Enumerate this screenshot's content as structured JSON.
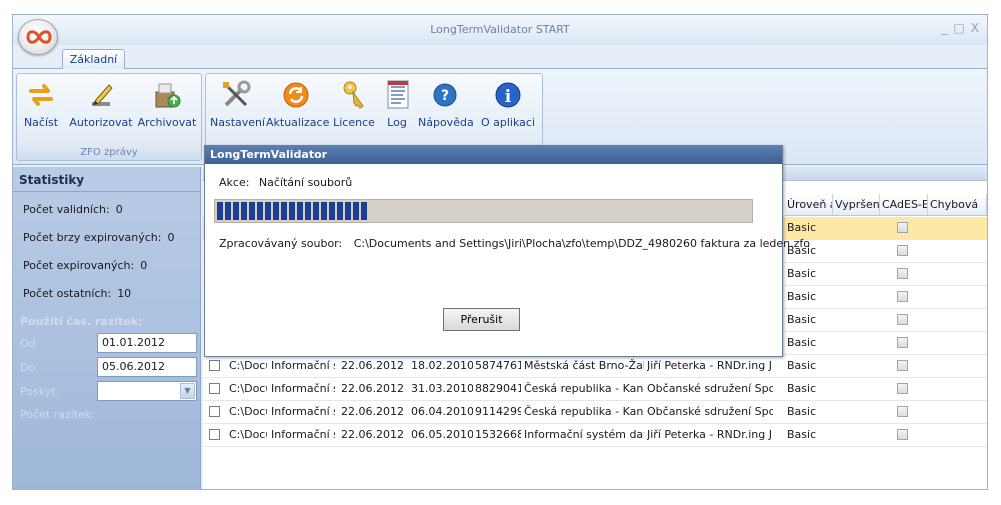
{
  "window": {
    "title": "LongTermValidator START",
    "controls": [
      "_",
      "□",
      "X"
    ]
  },
  "ribbon": {
    "tab": "Základní",
    "group1": {
      "label": "ZFO zprávy",
      "buttons": [
        {
          "label": "Načíst",
          "icon": "refresh-arrows-icon"
        },
        {
          "label": "Autorizovat",
          "icon": "pencil-icon"
        },
        {
          "label": "Archivovat",
          "icon": "archive-upload-icon"
        }
      ]
    },
    "group2": {
      "buttons": [
        {
          "label": "Nastavení",
          "icon": "tools-icon"
        },
        {
          "label": "Aktualizace",
          "icon": "update-icon"
        },
        {
          "label": "Licence",
          "icon": "key-icon"
        },
        {
          "label": "Log",
          "icon": "log-document-icon"
        },
        {
          "label": "Nápověda",
          "icon": "help-icon"
        },
        {
          "label": "O aplikaci",
          "icon": "info-icon"
        }
      ]
    }
  },
  "stats": {
    "title": "Statistiky",
    "items": [
      {
        "label": "Počet validních:",
        "value": "0"
      },
      {
        "label": "Počet brzy expirovaných:",
        "value": "0"
      },
      {
        "label": "Počet expirovaných:",
        "value": "0"
      },
      {
        "label": "Počet ostatních:",
        "value": "10"
      }
    ]
  },
  "timestamps": {
    "title": "Použití čas. razítek:",
    "od_label": "Od",
    "od_value": "01.01.2012",
    "do_label": "Do",
    "do_value": "05.06.2012",
    "poskytovatel_label": "Poskyt.",
    "pocet_label": "Počet razítek:"
  },
  "grid": {
    "headers": [
      "Úroveň archiv",
      "Vypršení",
      "CAdES-E",
      "Chybová"
    ],
    "rows": [
      {
        "path": "C:\\Docu",
        "sender": "Informační sy",
        "date1": "22.06.2012",
        "date2": "18.02.2010",
        "id": "5874761",
        "recipient": "Městská část Brno-Žabo",
        "signer": "Jiří Peterka - RNDr.ing J",
        "level": "Basic"
      },
      {
        "path": "C:\\Docu",
        "sender": "Informační sy",
        "date1": "22.06.2012",
        "date2": "31.03.2010",
        "id": "8829041",
        "recipient": "Česká republika - Kanc",
        "signer": "Občanské sdružení Spol",
        "level": "Basic"
      },
      {
        "path": "C:\\Docu",
        "sender": "Informační sy",
        "date1": "22.06.2012",
        "date2": "06.04.2010",
        "id": "9114299",
        "recipient": "Česká republika - Kanc",
        "signer": "Občanské sdružení Spol",
        "level": "Basic"
      },
      {
        "path": "C:\\Docu",
        "sender": "Informační sy",
        "date1": "22.06.2012",
        "date2": "06.05.2010",
        "id": "1532668",
        "recipient": "Informační systém datc",
        "signer": "Jiří Peterka - RNDr.ing J",
        "level": "Basic"
      }
    ],
    "hidden_row_levels": [
      "Basic",
      "Basic",
      "Basic",
      "Basic",
      "Basic",
      "Basic"
    ]
  },
  "dialog": {
    "title": "LongTermValidator",
    "akce_label": "Akce:",
    "akce_value": "Načítání souborů",
    "progress_percent": 29,
    "file_label": "Zpracovávaný soubor:",
    "file_value": "C:\\Documents and Settings\\Jiri\\Plocha\\zfo\\temp\\DDZ_4980260 faktura za leden.zfo",
    "cancel_button": "Přerušit"
  }
}
